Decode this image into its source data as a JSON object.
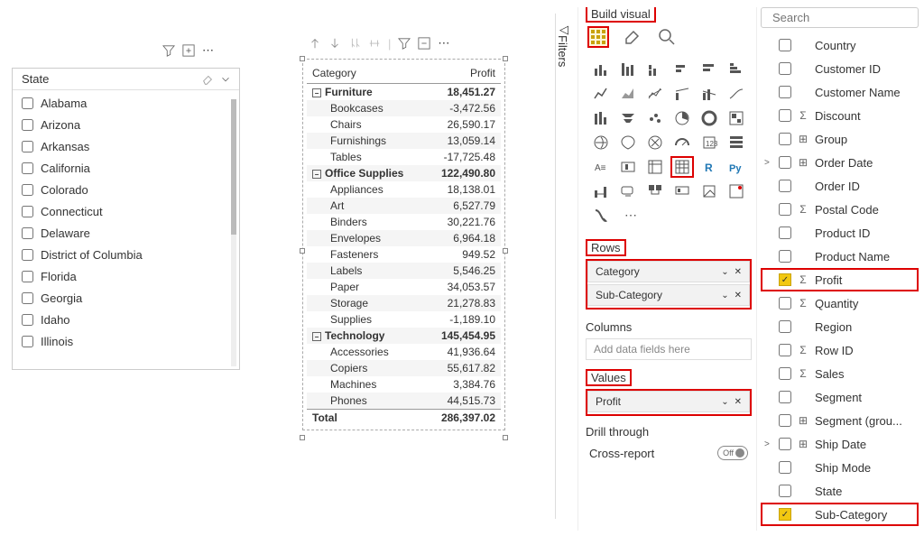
{
  "slicer": {
    "title": "State",
    "items": [
      "Alabama",
      "Arizona",
      "Arkansas",
      "California",
      "Colorado",
      "Connecticut",
      "Delaware",
      "District of Columbia",
      "Florida",
      "Georgia",
      "Idaho",
      "Illinois"
    ]
  },
  "matrix": {
    "columns": [
      "Category",
      "Profit"
    ],
    "rows": [
      {
        "type": "cat",
        "label": "Furniture",
        "value": "18,451.27"
      },
      {
        "type": "sub",
        "label": "Bookcases",
        "value": "-3,472.56"
      },
      {
        "type": "sub",
        "label": "Chairs",
        "value": "26,590.17"
      },
      {
        "type": "sub",
        "label": "Furnishings",
        "value": "13,059.14"
      },
      {
        "type": "sub",
        "label": "Tables",
        "value": "-17,725.48"
      },
      {
        "type": "cat",
        "label": "Office Supplies",
        "value": "122,490.80"
      },
      {
        "type": "sub",
        "label": "Appliances",
        "value": "18,138.01"
      },
      {
        "type": "sub",
        "label": "Art",
        "value": "6,527.79"
      },
      {
        "type": "sub",
        "label": "Binders",
        "value": "30,221.76"
      },
      {
        "type": "sub",
        "label": "Envelopes",
        "value": "6,964.18"
      },
      {
        "type": "sub",
        "label": "Fasteners",
        "value": "949.52"
      },
      {
        "type": "sub",
        "label": "Labels",
        "value": "5,546.25"
      },
      {
        "type": "sub",
        "label": "Paper",
        "value": "34,053.57"
      },
      {
        "type": "sub",
        "label": "Storage",
        "value": "21,278.83"
      },
      {
        "type": "sub",
        "label": "Supplies",
        "value": "-1,189.10"
      },
      {
        "type": "cat",
        "label": "Technology",
        "value": "145,454.95"
      },
      {
        "type": "sub",
        "label": "Accessories",
        "value": "41,936.64"
      },
      {
        "type": "sub",
        "label": "Copiers",
        "value": "55,617.82"
      },
      {
        "type": "sub",
        "label": "Machines",
        "value": "3,384.76"
      },
      {
        "type": "sub",
        "label": "Phones",
        "value": "44,515.73"
      }
    ],
    "total_label": "Total",
    "total_value": "286,397.02"
  },
  "filters_label": "Filters",
  "build": {
    "title": "Build visual",
    "rows_label": "Rows",
    "columns_label": "Columns",
    "columns_placeholder": "Add data fields here",
    "values_label": "Values",
    "drill_label": "Drill through",
    "cross_report_label": "Cross-report",
    "cross_report_state": "Off",
    "row_wells": [
      "Category",
      "Sub-Category"
    ],
    "value_wells": [
      "Profit"
    ]
  },
  "search_placeholder": "Search",
  "fields": [
    {
      "label": "Country",
      "checked": false,
      "icon": "",
      "expand": ""
    },
    {
      "label": "Customer ID",
      "checked": false,
      "icon": "",
      "expand": ""
    },
    {
      "label": "Customer Name",
      "checked": false,
      "icon": "",
      "expand": ""
    },
    {
      "label": "Discount",
      "checked": false,
      "icon": "Σ",
      "expand": ""
    },
    {
      "label": "Group",
      "checked": false,
      "icon": "⊞",
      "expand": ""
    },
    {
      "label": "Order Date",
      "checked": false,
      "icon": "⊞",
      "expand": ">"
    },
    {
      "label": "Order ID",
      "checked": false,
      "icon": "",
      "expand": ""
    },
    {
      "label": "Postal Code",
      "checked": false,
      "icon": "Σ",
      "expand": ""
    },
    {
      "label": "Product ID",
      "checked": false,
      "icon": "",
      "expand": ""
    },
    {
      "label": "Product Name",
      "checked": false,
      "icon": "",
      "expand": ""
    },
    {
      "label": "Profit",
      "checked": true,
      "icon": "Σ",
      "expand": "",
      "hl": true
    },
    {
      "label": "Quantity",
      "checked": false,
      "icon": "Σ",
      "expand": ""
    },
    {
      "label": "Region",
      "checked": false,
      "icon": "",
      "expand": ""
    },
    {
      "label": "Row ID",
      "checked": false,
      "icon": "Σ",
      "expand": ""
    },
    {
      "label": "Sales",
      "checked": false,
      "icon": "Σ",
      "expand": ""
    },
    {
      "label": "Segment",
      "checked": false,
      "icon": "",
      "expand": ""
    },
    {
      "label": "Segment (grou...",
      "checked": false,
      "icon": "⊞",
      "expand": ""
    },
    {
      "label": "Ship Date",
      "checked": false,
      "icon": "⊞",
      "expand": ">"
    },
    {
      "label": "Ship Mode",
      "checked": false,
      "icon": "",
      "expand": ""
    },
    {
      "label": "State",
      "checked": false,
      "icon": "",
      "expand": ""
    },
    {
      "label": "Sub-Category",
      "checked": true,
      "icon": "",
      "expand": "",
      "hl": true
    }
  ]
}
